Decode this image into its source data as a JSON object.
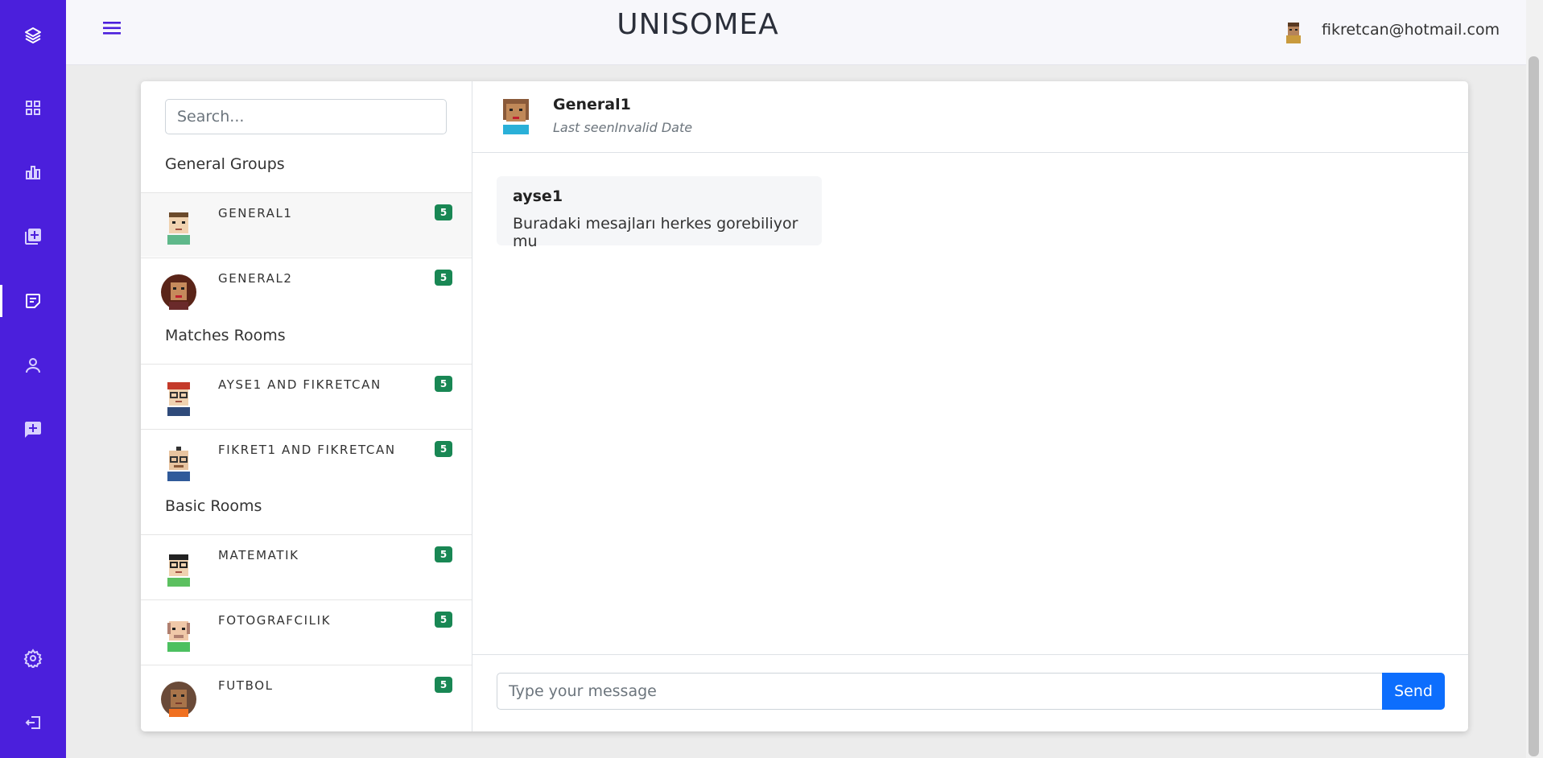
{
  "app": {
    "title": "UNISOMEA"
  },
  "colors": {
    "sidebar": "#4b1fdc",
    "badge": "#198754",
    "send_button": "#0d6efd"
  },
  "sidebar": {
    "items": [
      {
        "icon": "layers-icon"
      },
      {
        "icon": "dashboard-grid-icon"
      },
      {
        "icon": "bar-chart-icon"
      },
      {
        "icon": "add-collection-icon"
      },
      {
        "icon": "chat-icon",
        "active": true
      },
      {
        "icon": "user-icon"
      },
      {
        "icon": "message-plus-icon"
      },
      {
        "icon": "settings-icon"
      },
      {
        "icon": "logout-icon"
      }
    ]
  },
  "header": {
    "menu_icon": "hamburger-icon",
    "user_email": "fikretcan@hotmail.com"
  },
  "search": {
    "placeholder": "Search..."
  },
  "sections": [
    {
      "title": "General Groups",
      "rooms": [
        {
          "name": "GENERAL1",
          "badge": "5",
          "selected": true
        },
        {
          "name": "GENERAL2",
          "badge": "5"
        }
      ]
    },
    {
      "title": "Matches Rooms",
      "rooms": [
        {
          "name": "AYSE1 AND FIKRETCAN",
          "badge": "5"
        },
        {
          "name": "FIKRET1 AND FIKRETCAN",
          "badge": "5"
        }
      ]
    },
    {
      "title": "Basic Rooms",
      "rooms": [
        {
          "name": "MATEMATIK",
          "badge": "5"
        },
        {
          "name": "FOTOGRAFCILIK",
          "badge": "5"
        },
        {
          "name": "FUTBOL",
          "badge": "5"
        }
      ]
    }
  ],
  "chat": {
    "name": "General1",
    "status": "Last seenInvalid Date",
    "messages": [
      {
        "author": "ayse1",
        "text": "Buradaki mesajları herkes gorebiliyor mu"
      }
    ]
  },
  "composer": {
    "placeholder": "Type your message",
    "send_label": "Send"
  }
}
